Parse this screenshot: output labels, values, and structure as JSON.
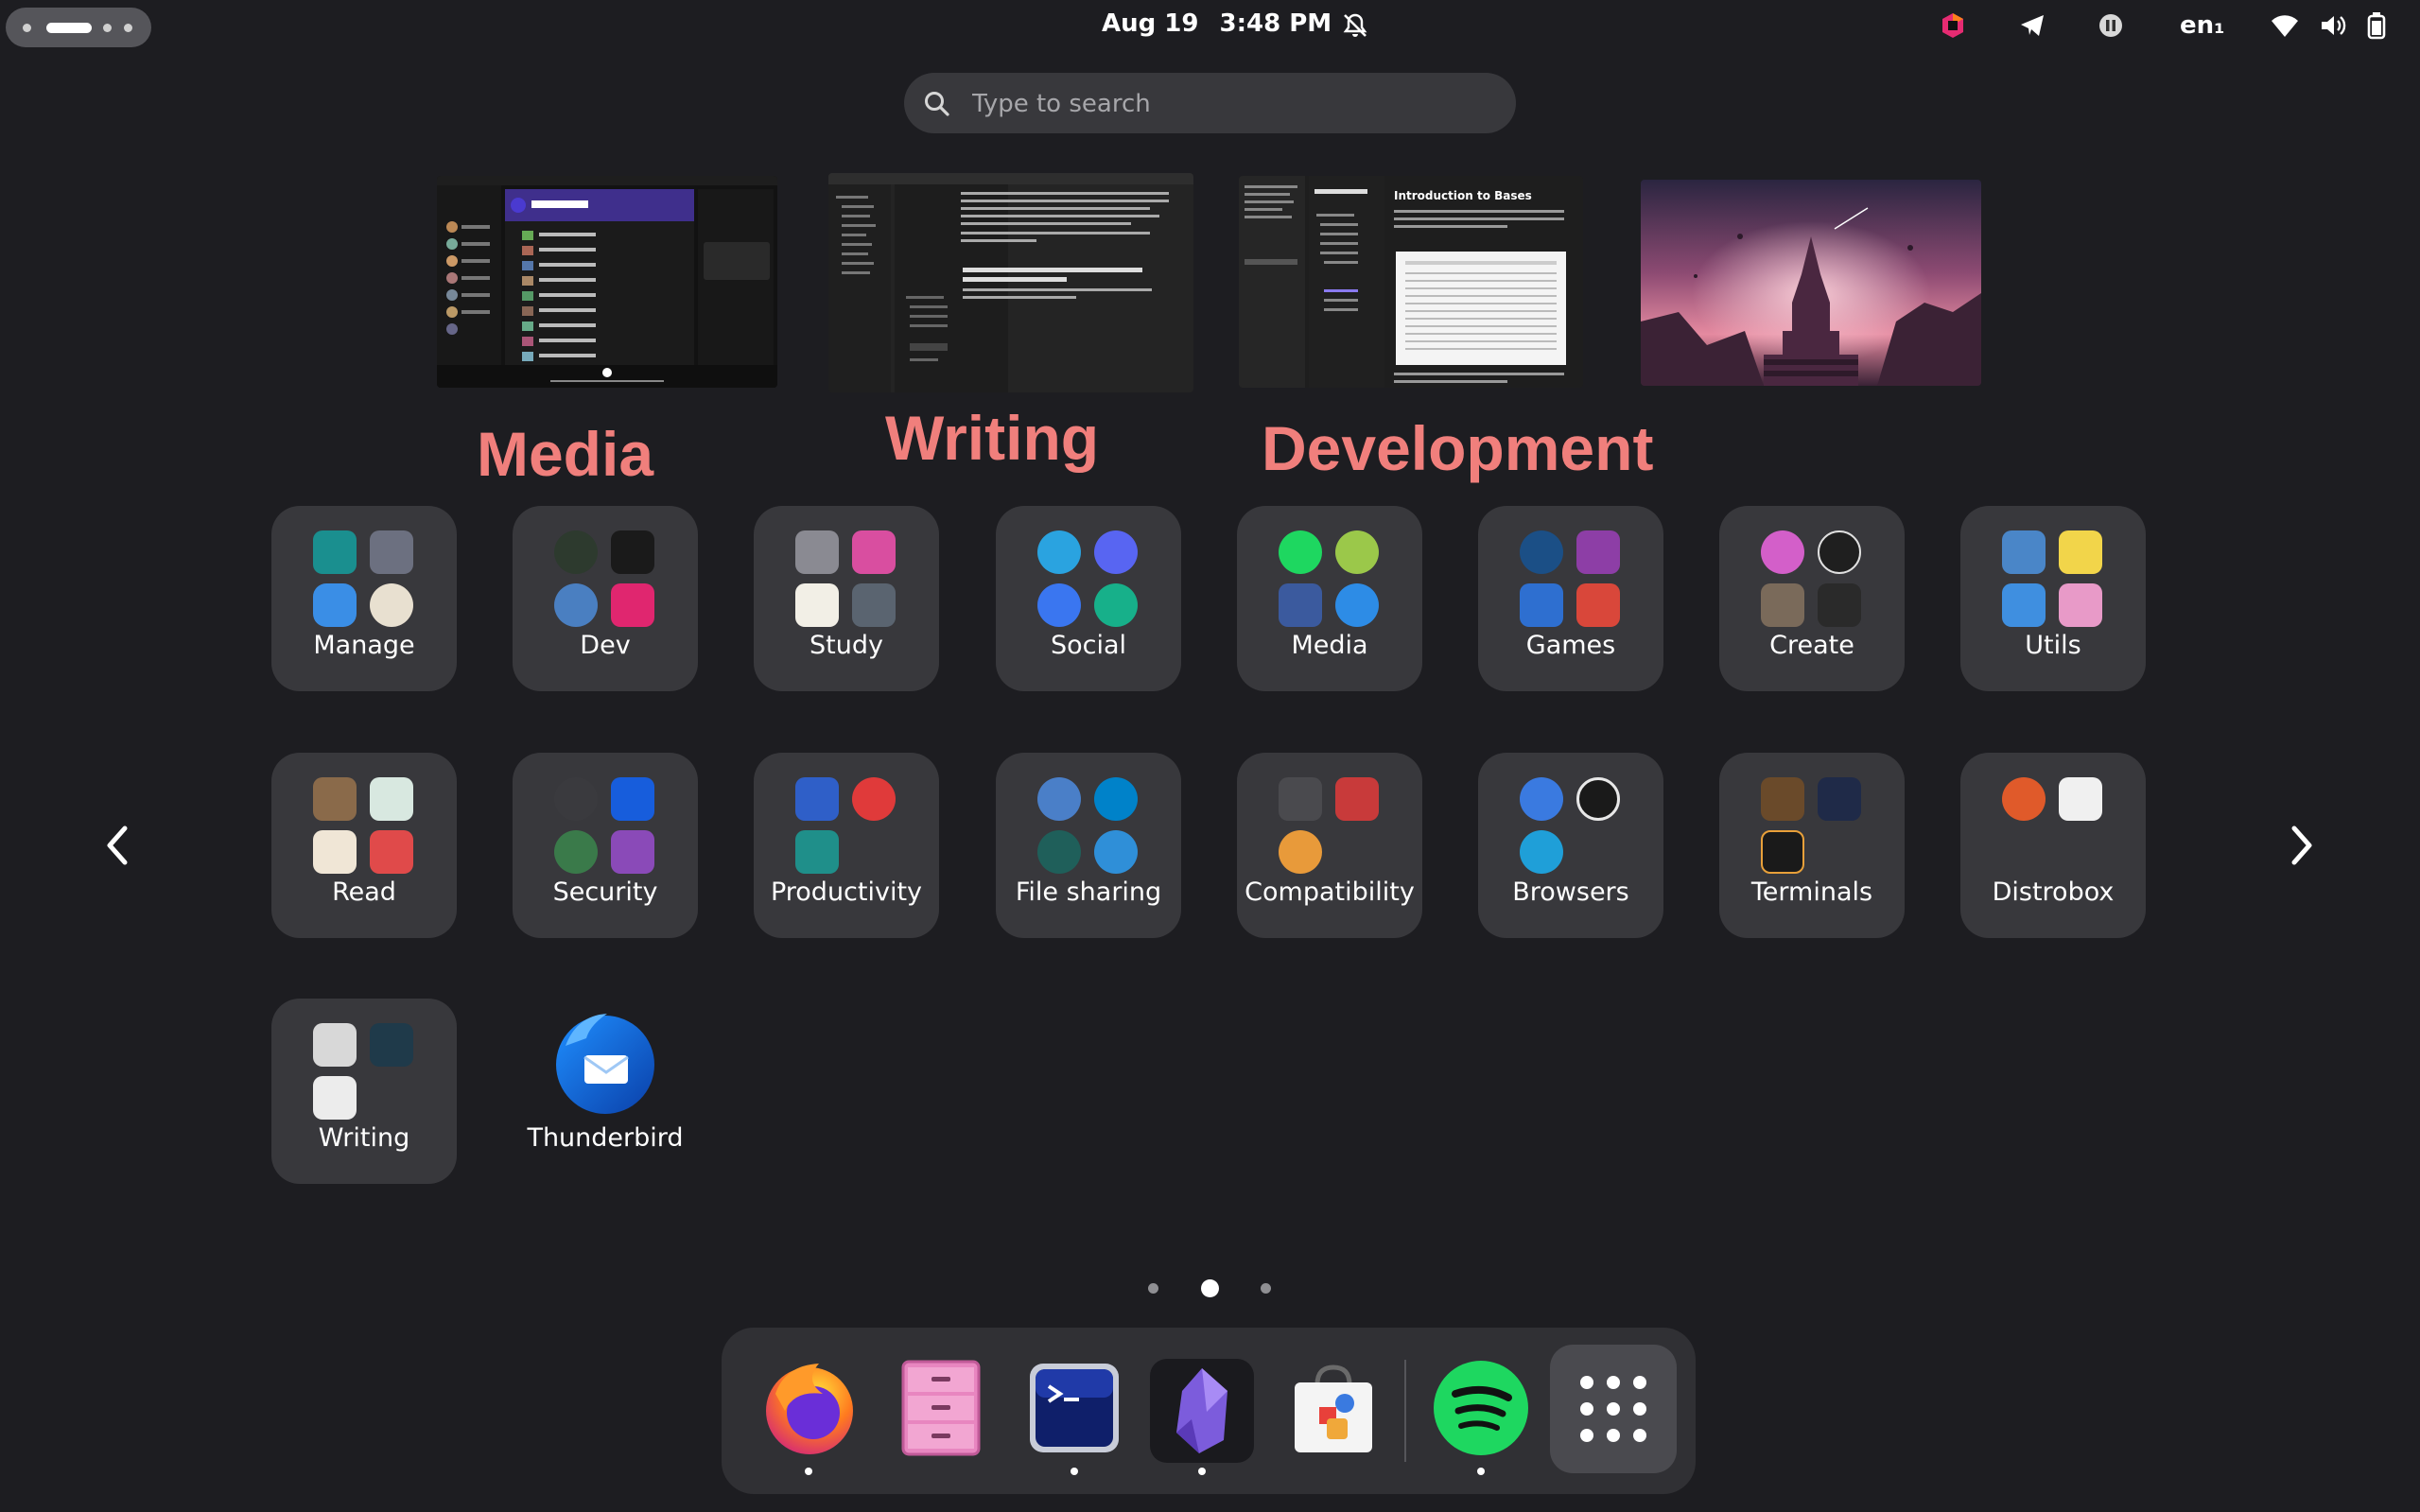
{
  "topbar": {
    "date": "Aug 19",
    "time": "3:48 PM",
    "language": "en₁"
  },
  "search": {
    "placeholder": "Type to search"
  },
  "workspaces": [
    {
      "label": "Media",
      "content": "Spotify library"
    },
    {
      "label": "Writing",
      "content": "Text editor",
      "doc_heading": "Smooth virtual desktops, clear separation of concerns",
      "doc_body": "GNOME might just have the cleanest, smoothest implementation of virtual desktops I have ever used."
    },
    {
      "label": "Development",
      "content": "Obsidian notes",
      "doc_title": "Introduction to Bases"
    },
    {
      "label": "",
      "content": "Wallpaper landscape"
    }
  ],
  "app_folders": [
    {
      "name": "Manage"
    },
    {
      "name": "Dev"
    },
    {
      "name": "Study"
    },
    {
      "name": "Social"
    },
    {
      "name": "Media"
    },
    {
      "name": "Games"
    },
    {
      "name": "Create"
    },
    {
      "name": "Utils"
    },
    {
      "name": "Read"
    },
    {
      "name": "Security"
    },
    {
      "name": "Productivity"
    },
    {
      "name": "File sharing"
    },
    {
      "name": "Compatibility"
    },
    {
      "name": "Browsers"
    },
    {
      "name": "Terminals"
    },
    {
      "name": "Distrobox"
    },
    {
      "name": "Writing"
    }
  ],
  "apps": [
    {
      "name": "Thunderbird",
      "icon": "thunderbird-icon"
    }
  ],
  "pagination": {
    "pages": 3,
    "current": 2
  },
  "dock": [
    {
      "name": "Firefox",
      "icon": "firefox-icon",
      "running": true
    },
    {
      "name": "Files",
      "icon": "file-cabinet-icon",
      "running": false
    },
    {
      "name": "Terminal",
      "icon": "terminal-icon",
      "running": true
    },
    {
      "name": "Obsidian",
      "icon": "obsidian-icon",
      "running": true
    },
    {
      "name": "Software",
      "icon": "shopping-bag-icon",
      "running": false
    },
    {
      "name": "Spotify",
      "icon": "spotify-icon",
      "running": true
    },
    {
      "name": "Show Apps",
      "icon": "app-grid-icon",
      "running": false
    }
  ],
  "colors": {
    "background": "#1d1d21",
    "tile": "#38383c",
    "workspace_label": "#f07f7c",
    "dock": "#303034"
  }
}
